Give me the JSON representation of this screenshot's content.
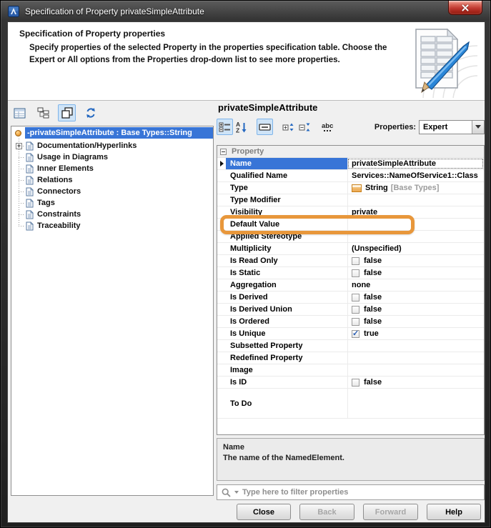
{
  "window": {
    "title": "Specification of Property privateSimpleAttribute",
    "controls": [
      {
        "name": "close-button",
        "icon": "close-icon"
      }
    ],
    "app_icon": "magicdraw-app-icon"
  },
  "header": {
    "title": "Specification of Property properties",
    "description": "Specify properties of the selected Property in the properties specification table. Choose the Expert or All options from the Properties drop-down list to see more properties.",
    "illustration": "document-pencil-illustration"
  },
  "left_panel": {
    "toolbar": [
      {
        "name": "properties-view-icon",
        "selected": false
      },
      {
        "name": "tree-view-icon",
        "selected": false
      },
      {
        "name": "cascade-view-icon",
        "selected": true
      },
      {
        "name": "refresh-icon",
        "selected": false
      }
    ],
    "tree": {
      "root": {
        "label": "-privateSimpleAttribute : Base Types::String",
        "selected": true,
        "icon": "property-node-icon"
      },
      "items": [
        {
          "label": "Documentation/Hyperlinks",
          "expandable": true,
          "icon": "page-icon"
        },
        {
          "label": "Usage in Diagrams",
          "icon": "page-icon"
        },
        {
          "label": "Inner Elements",
          "icon": "page-icon"
        },
        {
          "label": "Relations",
          "icon": "page-icon"
        },
        {
          "label": "Connectors",
          "icon": "page-icon"
        },
        {
          "label": "Tags",
          "icon": "page-icon"
        },
        {
          "label": "Constraints",
          "icon": "page-icon"
        },
        {
          "label": "Traceability",
          "icon": "page-icon"
        }
      ]
    }
  },
  "panel": {
    "title": "privateSimpleAttribute",
    "toolbar": [
      {
        "name": "categorized-view-icon",
        "selected": true
      },
      {
        "name": "sort-alphabetically-icon",
        "selected": false
      },
      {
        "name": "description-area-icon",
        "selected": true
      },
      {
        "name": "expand-all-icon",
        "selected": false
      },
      {
        "name": "collapse-all-icon",
        "selected": false
      },
      {
        "name": "abbreviations-icon",
        "selected": false
      }
    ],
    "properties_label": "Properties:",
    "properties_mode": "Expert",
    "group_label": "Property",
    "rows": [
      {
        "label": "Name",
        "value": "privateSimpleAttribute",
        "kind": "text",
        "selected": true
      },
      {
        "label": "Qualified Name",
        "value": "Services::NameOfService1::Class",
        "kind": "text"
      },
      {
        "label": "Type",
        "value": "String",
        "suffix": "[Base Types]",
        "kind": "type"
      },
      {
        "label": "Type Modifier",
        "value": "",
        "kind": "empty"
      },
      {
        "label": "Visibility",
        "value": "private",
        "kind": "text"
      },
      {
        "label": "Default Value",
        "value": "",
        "kind": "empty",
        "callout": true
      },
      {
        "label": "Applied Stereotype",
        "value": "",
        "kind": "empty"
      },
      {
        "label": "Multiplicity",
        "value": "(Unspecified)",
        "kind": "text"
      },
      {
        "label": "Is Read Only",
        "value": "false",
        "kind": "checkbox",
        "checked": false
      },
      {
        "label": "Is Static",
        "value": "false",
        "kind": "checkbox",
        "checked": false
      },
      {
        "label": "Aggregation",
        "value": "none",
        "kind": "text"
      },
      {
        "label": "Is Derived",
        "value": "false",
        "kind": "checkbox",
        "checked": false
      },
      {
        "label": "Is Derived Union",
        "value": "false",
        "kind": "checkbox",
        "checked": false
      },
      {
        "label": "Is Ordered",
        "value": "false",
        "kind": "checkbox",
        "checked": false
      },
      {
        "label": "Is Unique",
        "value": "true",
        "kind": "checkbox",
        "checked": true
      },
      {
        "label": "Subsetted Property",
        "value": "",
        "kind": "empty"
      },
      {
        "label": "Redefined Property",
        "value": "",
        "kind": "empty"
      },
      {
        "label": "Image",
        "value": "",
        "kind": "empty"
      },
      {
        "label": "Is ID",
        "value": "false",
        "kind": "checkbox",
        "checked": false
      },
      {
        "label": "To Do",
        "value": "",
        "kind": "empty",
        "tall": true
      }
    ],
    "description": {
      "title": "Name",
      "text": "The name of the NamedElement."
    },
    "filter": {
      "placeholder": "Type here to filter properties",
      "icon": "search-icon"
    }
  },
  "footer": {
    "buttons": [
      {
        "label": "Close",
        "enabled": true
      },
      {
        "label": "Back",
        "enabled": false
      },
      {
        "label": "Forward",
        "enabled": false
      },
      {
        "label": "Help",
        "enabled": true
      }
    ]
  },
  "colors": {
    "selection_blue": "#3875D7",
    "callout_orange": "#E8973B",
    "close_red": "#C03A31"
  }
}
